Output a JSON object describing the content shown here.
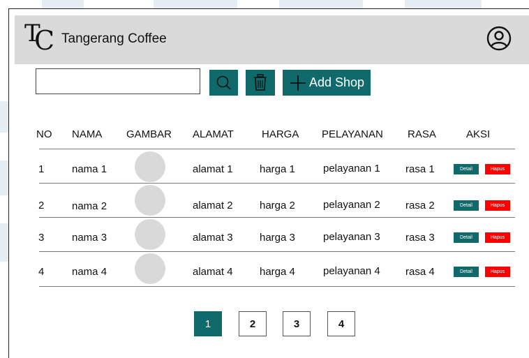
{
  "header": {
    "logo_letters": "TC",
    "title": "Tangerang Coffee",
    "profile_icon": "user-circle-icon"
  },
  "toolbar": {
    "search_value": "",
    "search_icon": "search-icon",
    "delete_icon": "trash-icon",
    "add_label": "Add Shop"
  },
  "table": {
    "headers": [
      "NO",
      "NAMA",
      "GAMBAR",
      "ALAMAT",
      "HARGA",
      "PELAYANAN",
      "RASA",
      "AKSI"
    ],
    "rows": [
      {
        "no": "1",
        "nama": "nama 1",
        "alamat": "alamat 1",
        "harga": "harga 1",
        "pelayanan": "pelayanan 1",
        "rasa": "rasa 1",
        "detail": "Detail",
        "hapus": "Hapus"
      },
      {
        "no": "2",
        "nama": "nama 2",
        "alamat": "alamat 2",
        "harga": "harga 2",
        "pelayanan": "pelayanan 2",
        "rasa": "rasa 2",
        "detail": "Detail",
        "hapus": "Hapus"
      },
      {
        "no": "3",
        "nama": "nama 3",
        "alamat": "alamat 3",
        "harga": "harga 3",
        "pelayanan": "pelayanan 3",
        "rasa": "rasa 3",
        "detail": "Detail",
        "hapus": "Hapus"
      },
      {
        "no": "4",
        "nama": "nama 4",
        "alamat": "alamat 4",
        "harga": "harga 4",
        "pelayanan": "pelayanan 4",
        "rasa": "rasa 4",
        "detail": "Detail",
        "hapus": "Hapus"
      }
    ]
  },
  "pagination": {
    "pages": [
      "1",
      "2",
      "3",
      "4"
    ],
    "active": "1"
  },
  "colors": {
    "accent": "#106a6c",
    "danger": "#ff0000",
    "header_bg": "#dadada",
    "image_placeholder": "#d9d9d9"
  }
}
